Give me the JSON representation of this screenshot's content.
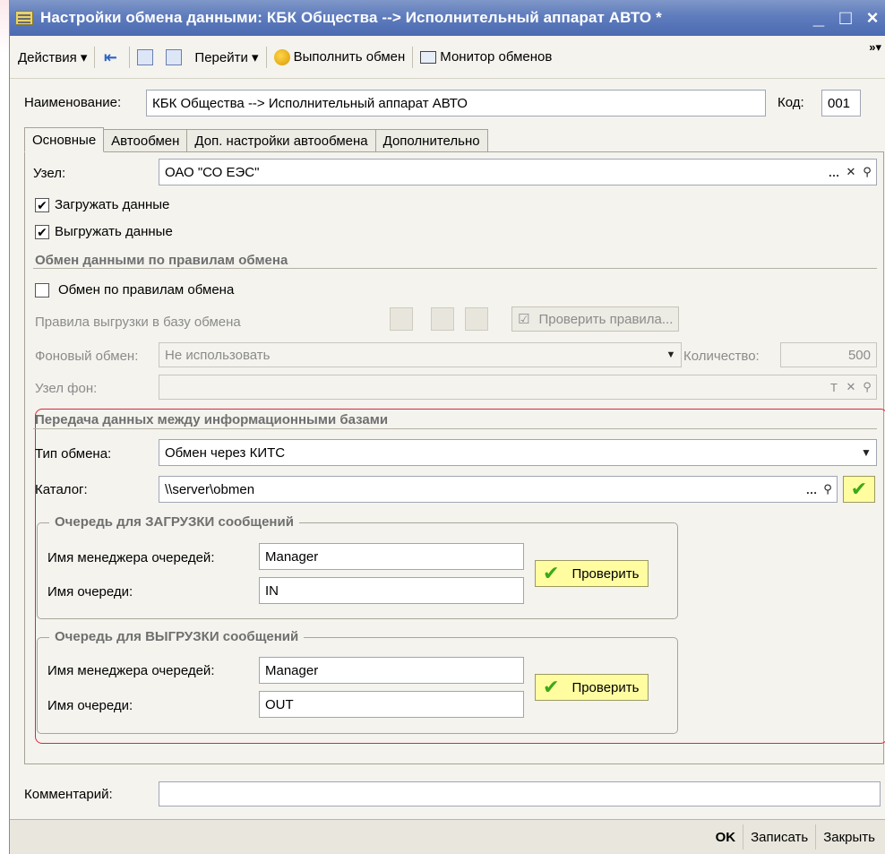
{
  "window": {
    "title": "Настройки обмена данными: КБК Общества --> Исполнительный аппарат АВТО *",
    "min": "_",
    "max": "□",
    "close": "×"
  },
  "toolbar": {
    "actions": "Действия ▾",
    "goto": "Перейти ▾",
    "run_exchange": "Выполнить обмен",
    "monitor": "Монитор обменов",
    "more": "»▾"
  },
  "header": {
    "name_label": "Наименование:",
    "name_value": "КБК Общества --> Исполнительный аппарат АВТО",
    "code_label": "Код:",
    "code_value": "001"
  },
  "tabs": [
    "Основные",
    "Автообмен",
    "Доп. настройки автообмена",
    "Дополнительно"
  ],
  "main": {
    "node_label": "Узел:",
    "node_value": "ОАО \"СО ЕЭС\"",
    "load_data": "Загружать данные",
    "unload_data": "Выгружать данные",
    "rules_section": "Обмен данными по правилам обмена",
    "exchange_by_rules": "Обмен по правилам обмена",
    "unload_rules": "Правила выгрузки в базу обмена",
    "check_rules": "Проверить правила...",
    "bg_exchange_label": "Фоновый обмен:",
    "bg_exchange_value": "Не использовать",
    "count_label": "Количество:",
    "count_value": "500",
    "bg_node_label": "Узел фон:",
    "bg_node_t": "T"
  },
  "transfer": {
    "section": "Передача данных между информационными базами",
    "type_label": "Тип обмена:",
    "type_value": "Обмен через КИТС",
    "catalog_label": "Каталог:",
    "catalog_value": "\\\\server\\obmen",
    "load_queue": {
      "title": "Очередь для ЗАГРУЗКИ сообщений",
      "manager_label": "Имя менеджера очередей:",
      "manager_value": "Manager",
      "queue_label": "Имя очереди:",
      "queue_value": "IN",
      "check": "Проверить"
    },
    "unload_queue": {
      "title": "Очередь для ВЫГРУЗКИ сообщений",
      "manager_label": "Имя менеджера очередей:",
      "manager_value": "Manager",
      "queue_label": "Имя очереди:",
      "queue_value": "OUT",
      "check": "Проверить"
    }
  },
  "comment": {
    "label": "Комментарий:",
    "value": ""
  },
  "footer": {
    "ok": "OK",
    "save": "Записать",
    "close": "Закрыть"
  },
  "colors": {
    "title_bar": "#5f7cbd",
    "highlight_border": "#d9283a",
    "check_button": "#fffda0"
  }
}
